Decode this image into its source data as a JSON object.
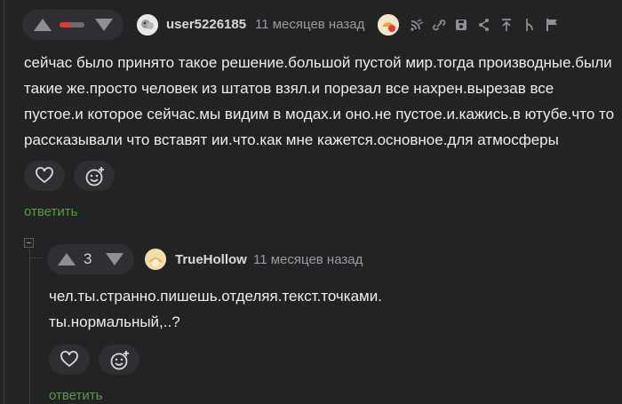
{
  "comment": {
    "author": "user5226185",
    "time": "11 месяцев назад",
    "rating_fill": 0.45,
    "lines": [
      "сейчас было принято такое решение.большой пустой мир.тогда производные.были",
      "такие же.просто человек из штатов взял.и порезал все нахрен.вырезав все",
      "пустое.и которое сейчас.мы видим в модах.и оно.не пустое.и.кажись.в ютубе.что то",
      "рассказывали что вставят ии.что.как мне кажется.основное.для атмосферы"
    ],
    "reply_label": "ответить",
    "icons": [
      "upvote-icon",
      "downvote-icon",
      "rss-icon",
      "link-icon",
      "save-icon",
      "share-icon",
      "scroll-up-icon",
      "branch-icon",
      "flag-icon",
      "heart-icon",
      "emoji-add-icon"
    ]
  },
  "reply": {
    "author": "TrueHollow",
    "time": "11 месяцев назад",
    "score": "3",
    "lines": [
      "чел.ты.странно.пишешь.отделяя.текст.точками.",
      "ты.нормальный,..?"
    ],
    "reply_label": "ответить"
  },
  "colors": {
    "background": "#222325",
    "reply_link": "#5a9b3c",
    "negative_rating": "#e13737"
  }
}
